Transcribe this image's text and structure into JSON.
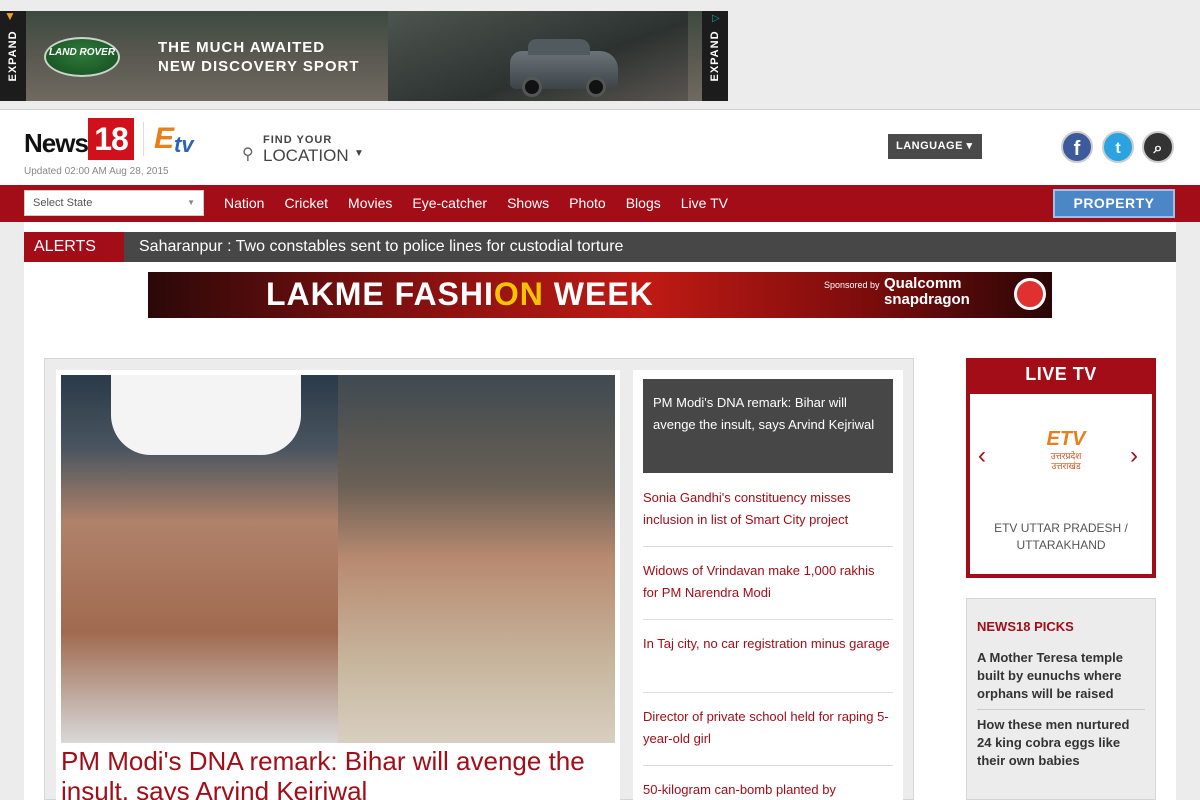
{
  "ad_top": {
    "expand_label": "EXPAND",
    "brand_logo": "LAND ROVER",
    "headline_line1": "THE MUCH AWAITED",
    "headline_line2": "NEW DISCOVERY SPORT"
  },
  "header": {
    "logo_text": "News",
    "logo_box": "18",
    "partner_logo": "ETV",
    "updated": "Updated 02:00 AM Aug 28, 2015",
    "location_small": "FIND YOUR",
    "location_big": "LOCATION",
    "language_label": "LANGUAGE"
  },
  "nav": {
    "state_placeholder": "Select State",
    "items": [
      "Nation",
      "Cricket",
      "Movies",
      "Eye-catcher",
      "Shows",
      "Photo",
      "Blogs",
      "Live TV"
    ],
    "property_label": "PROPERTY"
  },
  "alerts": {
    "label": "ALERTS",
    "message": "Saharanpur : Two constables sent to police lines for custodial torture"
  },
  "banner": {
    "title_part1": "LAKME FASHI",
    "title_part2": "ON",
    "title_part3": " WEEK",
    "sponsored": "Sponsored by",
    "sponsor_line1": "Qualcomm",
    "sponsor_line2": "snapdragon"
  },
  "main": {
    "headline": "PM Modi's DNA remark: Bihar will avenge the insult, says Arvind Kejriwal",
    "stories": [
      "PM Modi's DNA remark: Bihar will avenge the insult, says Arvind Kejriwal",
      "Sonia Gandhi's constituency misses inclusion in list of Smart City project",
      "Widows of Vrindavan make 1,000 rakhis for PM Narendra Modi",
      "In Taj city, no car registration minus garage",
      "Director of private school held for raping 5-year-old girl",
      "50-kilogram can-bomb planted by"
    ]
  },
  "live_tv": {
    "title": "LIVE TV",
    "logo_text": "ETV",
    "logo_sub": "उत्तरप्रदेश उत्तराखंड",
    "channel": "ETV UTTAR PRADESH / UTTARAKHAND"
  },
  "picks": {
    "title": "NEWS18 PICKS",
    "items": [
      "A Mother Teresa temple built by eunuchs where orphans will be raised",
      "How these men nurtured 24 king cobra eggs like their own babies"
    ]
  },
  "colors": {
    "brand_red": "#a30d17",
    "dark_grey": "#474747",
    "property_blue": "#4b86c6"
  }
}
